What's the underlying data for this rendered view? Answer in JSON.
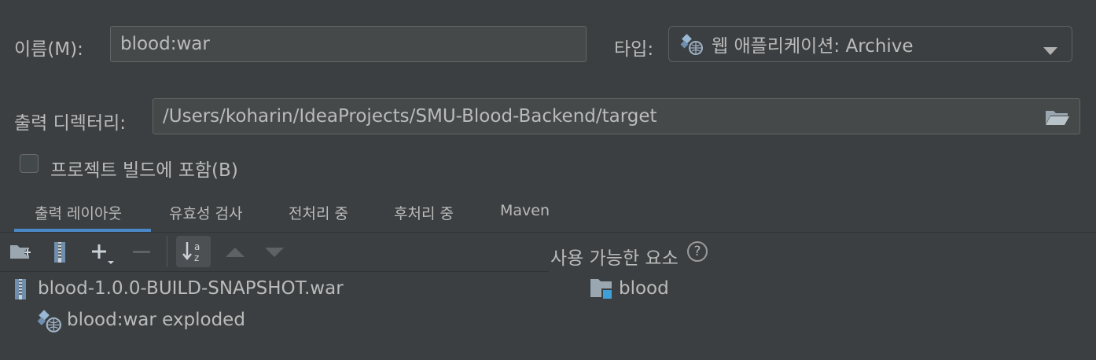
{
  "name": {
    "label": "이름(M):",
    "value": "blood:war"
  },
  "type": {
    "label": "타입:",
    "value": "웹 애플리케이션: Archive"
  },
  "output_dir": {
    "label": "출력 디렉터리:",
    "value": "/Users/koharin/IdeaProjects/SMU-Blood-Backend/target"
  },
  "include_in_build": {
    "label": "프로젝트 빌드에 포함(B)",
    "checked": false
  },
  "tabs": [
    {
      "label": "출력 레이아웃",
      "active": true
    },
    {
      "label": "유효성 검사",
      "active": false
    },
    {
      "label": "전처리 중",
      "active": false
    },
    {
      "label": "후처리 중",
      "active": false
    },
    {
      "label": "Maven",
      "active": false
    }
  ],
  "toolbar": {
    "icons": [
      "new-folder-icon",
      "archive-icon",
      "add-icon",
      "remove-icon",
      "sort-alpha-icon",
      "move-up-icon",
      "move-down-icon"
    ]
  },
  "available": {
    "label": "사용 가능한 요소",
    "help": "?"
  },
  "tree": [
    {
      "label": "blood-1.0.0-BUILD-SNAPSHOT.war",
      "icon": "war-archive-icon"
    },
    {
      "label": "blood:war exploded",
      "icon": "web-exploded-icon"
    }
  ],
  "available_tree": [
    {
      "label": "blood",
      "icon": "module-folder-icon"
    }
  ],
  "colors": {
    "accent": "#4a88c7",
    "background": "#3c3f41",
    "text": "#bbbbbb"
  }
}
